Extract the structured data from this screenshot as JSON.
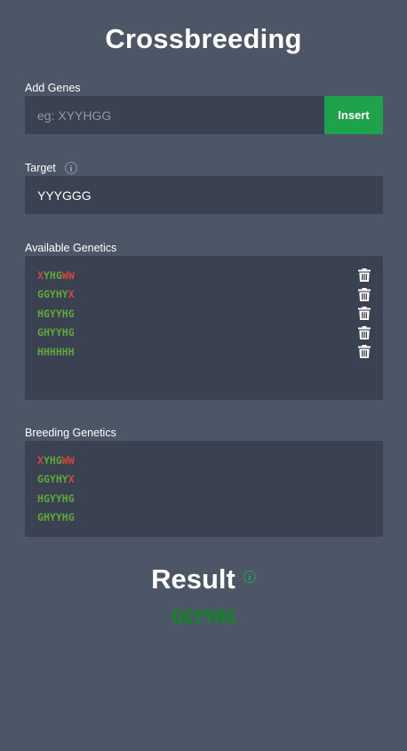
{
  "app": {
    "title": "Crossbreeding"
  },
  "add_genes": {
    "label": "Add Genes",
    "placeholder": "eg: XYYHGG",
    "button": "Insert"
  },
  "target": {
    "label": "Target",
    "value": "YYYGGG"
  },
  "available": {
    "label": "Available Genetics",
    "items": [
      {
        "text": "XYHGWW",
        "chars": [
          {
            "c": "X",
            "s": "bad"
          },
          {
            "c": "Y",
            "s": "good"
          },
          {
            "c": "H",
            "s": "good"
          },
          {
            "c": "G",
            "s": "good"
          },
          {
            "c": "W",
            "s": "bad"
          },
          {
            "c": "W",
            "s": "bad"
          }
        ]
      },
      {
        "text": "GGYHYX",
        "chars": [
          {
            "c": "G",
            "s": "good"
          },
          {
            "c": "G",
            "s": "good"
          },
          {
            "c": "Y",
            "s": "good"
          },
          {
            "c": "H",
            "s": "good"
          },
          {
            "c": "Y",
            "s": "good"
          },
          {
            "c": "X",
            "s": "bad"
          }
        ]
      },
      {
        "text": "HGYYHG",
        "chars": [
          {
            "c": "H",
            "s": "good"
          },
          {
            "c": "G",
            "s": "good"
          },
          {
            "c": "Y",
            "s": "good"
          },
          {
            "c": "Y",
            "s": "good"
          },
          {
            "c": "H",
            "s": "good"
          },
          {
            "c": "G",
            "s": "good"
          }
        ]
      },
      {
        "text": "GHYYHG",
        "chars": [
          {
            "c": "G",
            "s": "good"
          },
          {
            "c": "H",
            "s": "good"
          },
          {
            "c": "Y",
            "s": "good"
          },
          {
            "c": "Y",
            "s": "good"
          },
          {
            "c": "H",
            "s": "good"
          },
          {
            "c": "G",
            "s": "good"
          }
        ]
      },
      {
        "text": "HHHHHH",
        "chars": [
          {
            "c": "H",
            "s": "good"
          },
          {
            "c": "H",
            "s": "good"
          },
          {
            "c": "H",
            "s": "good"
          },
          {
            "c": "H",
            "s": "good"
          },
          {
            "c": "H",
            "s": "good"
          },
          {
            "c": "H",
            "s": "good"
          }
        ]
      }
    ]
  },
  "breeding": {
    "label": "Breeding Genetics",
    "items": [
      {
        "text": "XYHGWW",
        "chars": [
          {
            "c": "X",
            "s": "bad"
          },
          {
            "c": "Y",
            "s": "good"
          },
          {
            "c": "H",
            "s": "good"
          },
          {
            "c": "G",
            "s": "good"
          },
          {
            "c": "W",
            "s": "bad"
          },
          {
            "c": "W",
            "s": "bad"
          }
        ]
      },
      {
        "text": "GGYHYX",
        "chars": [
          {
            "c": "G",
            "s": "good"
          },
          {
            "c": "G",
            "s": "good"
          },
          {
            "c": "Y",
            "s": "good"
          },
          {
            "c": "H",
            "s": "good"
          },
          {
            "c": "Y",
            "s": "good"
          },
          {
            "c": "X",
            "s": "bad"
          }
        ]
      },
      {
        "text": "HGYYHG",
        "chars": [
          {
            "c": "H",
            "s": "good"
          },
          {
            "c": "G",
            "s": "good"
          },
          {
            "c": "Y",
            "s": "good"
          },
          {
            "c": "Y",
            "s": "good"
          },
          {
            "c": "H",
            "s": "good"
          },
          {
            "c": "G",
            "s": "good"
          }
        ]
      },
      {
        "text": "GHYYHG",
        "chars": [
          {
            "c": "G",
            "s": "good"
          },
          {
            "c": "H",
            "s": "good"
          },
          {
            "c": "Y",
            "s": "good"
          },
          {
            "c": "Y",
            "s": "good"
          },
          {
            "c": "H",
            "s": "good"
          },
          {
            "c": "G",
            "s": "good"
          }
        ]
      }
    ]
  },
  "result": {
    "label": "Result",
    "value": "GGYYHG"
  },
  "colors": {
    "background": "#4d5666",
    "field": "#3a4150",
    "accent": "#1ea34a",
    "good_gene": "#5fa839",
    "bad_gene": "#d3463c",
    "result": "#0b8a1e"
  },
  "icons": {
    "delete": "trash-icon",
    "info": "info-icon"
  }
}
